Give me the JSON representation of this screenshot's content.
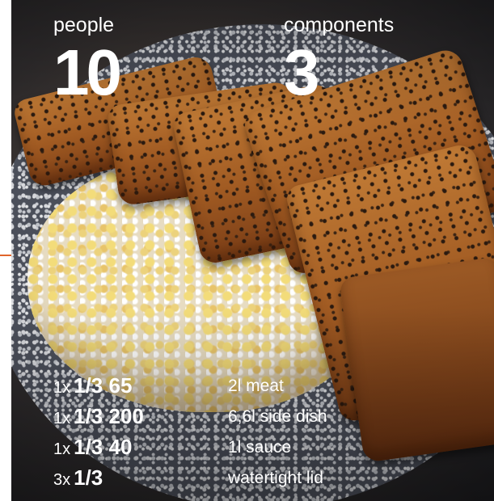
{
  "stats": {
    "people": {
      "label": "people",
      "value": "10"
    },
    "components": {
      "label": "components",
      "value": "3"
    }
  },
  "items": [
    {
      "qty": "1x",
      "size": "1/3 65",
      "description": "2l meat"
    },
    {
      "qty": "1x",
      "size": "1/3 200",
      "description": "6,6l side dish"
    },
    {
      "qty": "1x",
      "size": "1/3 40",
      "description": "1l sauce"
    },
    {
      "qty": "3x",
      "size": "1/3",
      "description": "watertight lid"
    }
  ],
  "colors": {
    "accent": "#e0642a",
    "text": "#ffffff"
  }
}
